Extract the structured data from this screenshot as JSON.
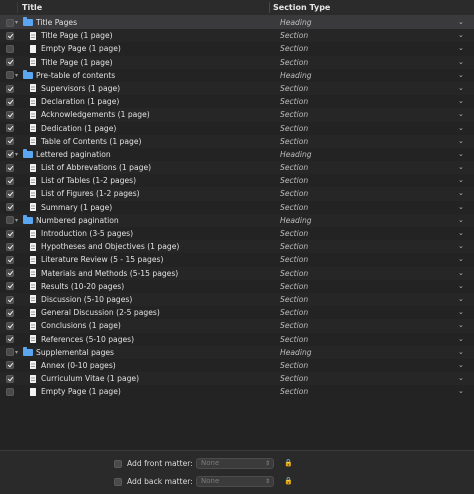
{
  "header": {
    "title": "Title",
    "section_type": "Section Type"
  },
  "rows": [
    {
      "label": "Title Pages",
      "type": "Heading",
      "kind": "heading",
      "checked": false,
      "icon": "folder-icon"
    },
    {
      "label": "Title Page (1 page)",
      "type": "Section",
      "kind": "section",
      "checked": true,
      "icon": "document-lined-icon"
    },
    {
      "label": "Empty Page (1 page)",
      "type": "Section",
      "kind": "section",
      "checked": false,
      "icon": "document-blank-icon"
    },
    {
      "label": "Title Page (1 page)",
      "type": "Section",
      "kind": "section",
      "checked": true,
      "icon": "document-lined-icon"
    },
    {
      "label": "Pre-table of contents",
      "type": "Heading",
      "kind": "heading",
      "checked": false,
      "icon": "folder-icon"
    },
    {
      "label": "Supervisors (1 page)",
      "type": "Section",
      "kind": "section",
      "checked": true,
      "icon": "document-lined-icon"
    },
    {
      "label": "Declaration (1 page)",
      "type": "Section",
      "kind": "section",
      "checked": true,
      "icon": "document-lined-icon"
    },
    {
      "label": "Acknowledgements (1 page)",
      "type": "Section",
      "kind": "section",
      "checked": true,
      "icon": "document-lined-icon"
    },
    {
      "label": "Dedication (1 page)",
      "type": "Section",
      "kind": "section",
      "checked": true,
      "icon": "document-lined-icon"
    },
    {
      "label": "Table of Contents (1 page)",
      "type": "Section",
      "kind": "section",
      "checked": true,
      "icon": "document-lined-icon"
    },
    {
      "label": "Lettered pagination",
      "type": "Heading",
      "kind": "heading",
      "checked": true,
      "icon": "folder-icon"
    },
    {
      "label": "List of Abbrevations (1 page)",
      "type": "Section",
      "kind": "section",
      "checked": true,
      "icon": "document-lined-icon"
    },
    {
      "label": "List of Tables (1-2 pages)",
      "type": "Section",
      "kind": "section",
      "checked": true,
      "icon": "document-lined-icon"
    },
    {
      "label": "List of Figures (1-2 pages)",
      "type": "Section",
      "kind": "section",
      "checked": true,
      "icon": "document-lined-icon"
    },
    {
      "label": "Summary (1 page)",
      "type": "Section",
      "kind": "section",
      "checked": true,
      "icon": "document-lined-icon"
    },
    {
      "label": "Numbered pagination",
      "type": "Heading",
      "kind": "heading",
      "checked": false,
      "icon": "folder-icon"
    },
    {
      "label": "Introduction (3-5 pages)",
      "type": "Section",
      "kind": "section",
      "checked": true,
      "icon": "document-lined-icon"
    },
    {
      "label": "Hypotheses and Objectives (1 page)",
      "type": "Section",
      "kind": "section",
      "checked": true,
      "icon": "document-lined-icon"
    },
    {
      "label": "Literature Review (5 - 15 pages)",
      "type": "Section",
      "kind": "section",
      "checked": true,
      "icon": "document-lined-icon"
    },
    {
      "label": "Materials and Methods (5-15 pages)",
      "type": "Section",
      "kind": "section",
      "checked": true,
      "icon": "document-lined-icon"
    },
    {
      "label": "Results (10-20 pages)",
      "type": "Section",
      "kind": "section",
      "checked": true,
      "icon": "document-lined-icon"
    },
    {
      "label": "Discussion (5-10 pages)",
      "type": "Section",
      "kind": "section",
      "checked": true,
      "icon": "document-lined-icon"
    },
    {
      "label": "General Discussion (2-5 pages)",
      "type": "Section",
      "kind": "section",
      "checked": true,
      "icon": "document-lined-icon"
    },
    {
      "label": "Conclusions (1 page)",
      "type": "Section",
      "kind": "section",
      "checked": true,
      "icon": "document-lined-icon"
    },
    {
      "label": "References (5-10 pages)",
      "type": "Section",
      "kind": "section",
      "checked": true,
      "icon": "document-lined-icon"
    },
    {
      "label": "Supplemental pages",
      "type": "Heading",
      "kind": "heading",
      "checked": false,
      "icon": "folder-icon"
    },
    {
      "label": "Annex (0-10 pages)",
      "type": "Section",
      "kind": "section",
      "checked": true,
      "icon": "document-lined-icon"
    },
    {
      "label": "Curriculum Vitae (1 page)",
      "type": "Section",
      "kind": "section",
      "checked": true,
      "icon": "document-lined-icon"
    },
    {
      "label": "Empty Page (1 page)",
      "type": "Section",
      "kind": "section",
      "checked": false,
      "icon": "document-blank-icon"
    }
  ],
  "footer": {
    "front_matter_label": "Add front matter:",
    "front_matter_value": "None",
    "back_matter_label": "Add back matter:",
    "back_matter_value": "None"
  },
  "colors": {
    "folder": "#5aa6f0",
    "background": "#232323",
    "selected_row": "#3a3a3c"
  }
}
